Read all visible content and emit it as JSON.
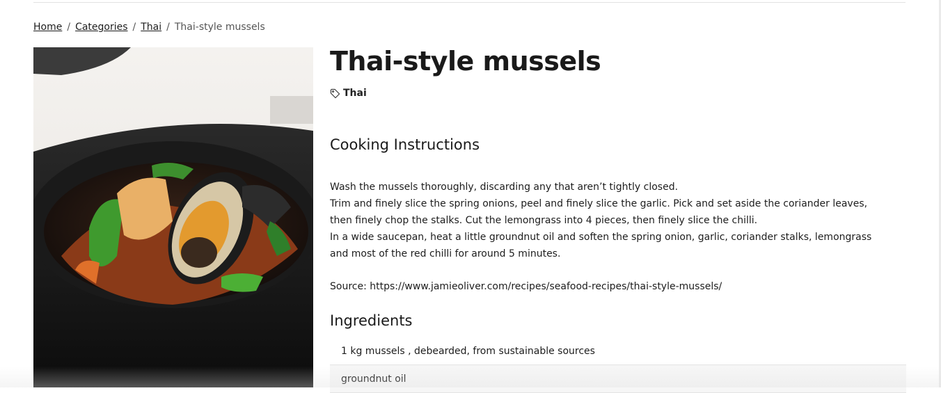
{
  "breadcrumb": {
    "items": [
      "Home",
      "Categories",
      "Thai"
    ],
    "separator": "/",
    "current": "Thai-style mussels"
  },
  "recipe": {
    "title": "Thai-style mussels",
    "tag": "Thai",
    "tag_icon": "tag-icon",
    "image_alt_icon": "mussels-photo"
  },
  "instructions": {
    "heading": "Cooking Instructions",
    "steps": [
      "Wash the mussels thoroughly, discarding any that aren’t tightly closed.",
      "Trim and finely slice the spring onions, peel and finely slice the garlic. Pick and set aside the coriander leaves, then finely chop the stalks. Cut the lemongrass into 4 pieces, then finely slice the chilli.",
      "In a wide saucepan, heat a little groundnut oil and soften the spring onion, garlic, coriander stalks, lemongrass and most of the red chilli for around 5 minutes."
    ],
    "source": "Source: https://www.jamieoliver.com/recipes/seafood-recipes/thai-style-mussels/"
  },
  "ingredients": {
    "heading": "Ingredients",
    "items": [
      "1 kg mussels , debearded, from sustainable sources",
      "groundnut oil"
    ]
  }
}
